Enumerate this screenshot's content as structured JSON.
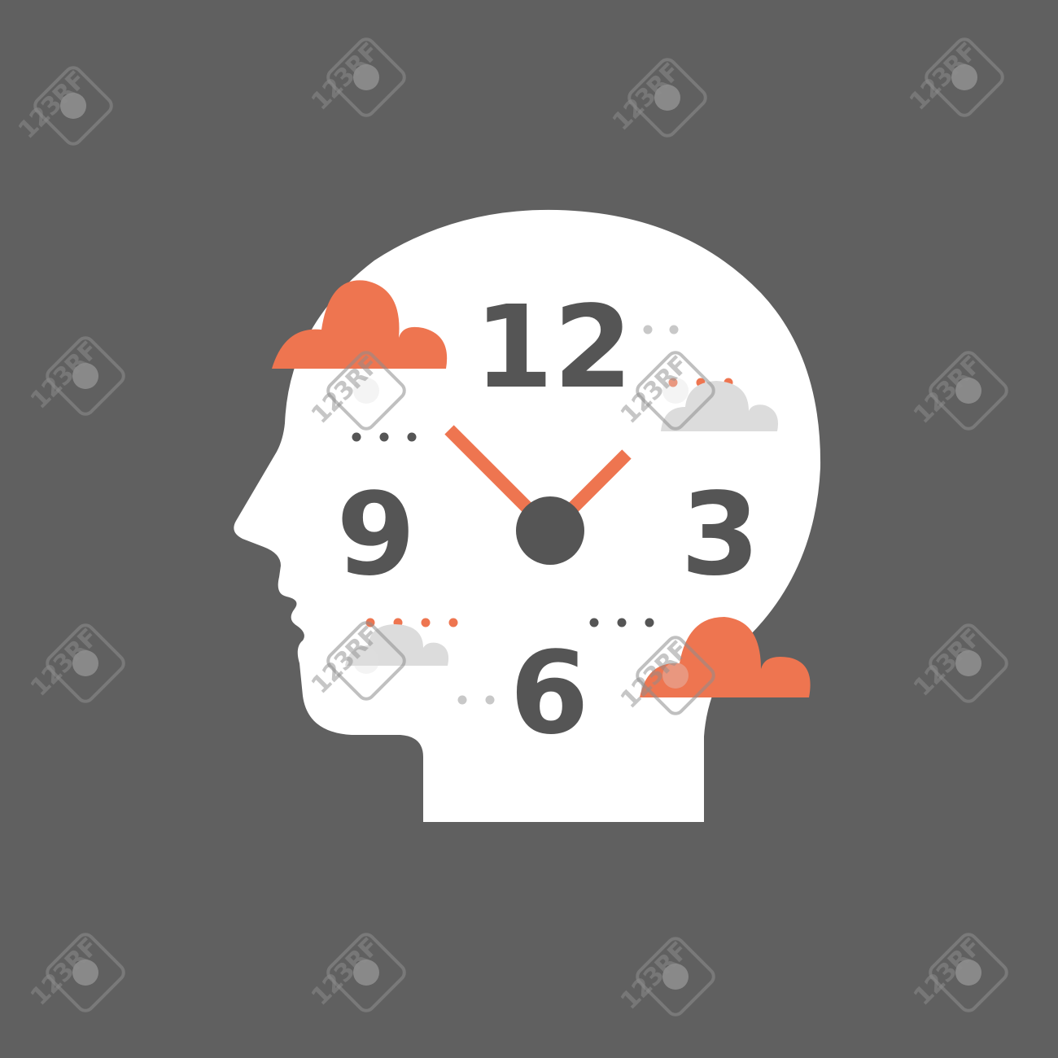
{
  "colors": {
    "background": "#606060",
    "head": "#ffffff",
    "numerals": "#555555",
    "accent": "#ee7550",
    "cloud_light": "#dcdcdc",
    "dot_light": "#c8c8c8",
    "watermark": "#8e8e8e",
    "watermark_inner": "#dedede"
  },
  "icons": {
    "head": "head-silhouette-icon",
    "cloud": "cloud-icon",
    "clock": "clock-icon",
    "watermark": "watermark-camera-icon"
  },
  "clock": {
    "numerals": {
      "twelve": "12",
      "three": "3",
      "six": "6",
      "nine": "9"
    }
  },
  "watermark": {
    "text": "123RF"
  }
}
